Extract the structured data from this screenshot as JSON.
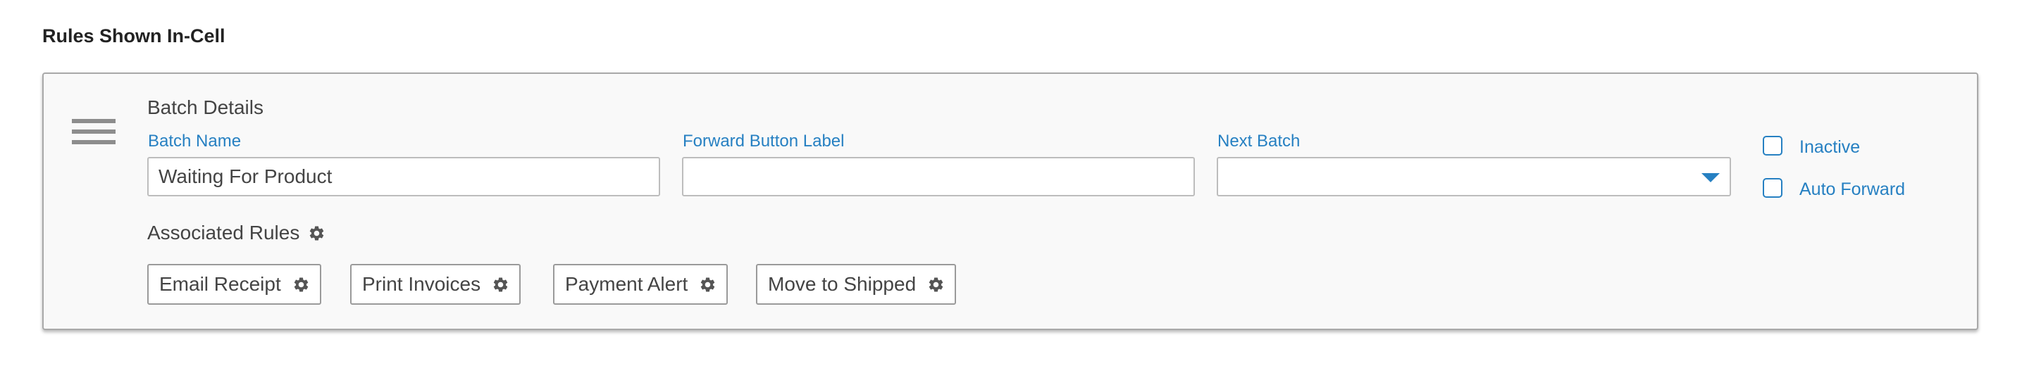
{
  "page": {
    "section_title": "Rules Shown In-Cell"
  },
  "card": {
    "heading": "Batch Details",
    "fields": {
      "batch_name": {
        "label": "Batch Name",
        "value": "Waiting For Product"
      },
      "forward_button_label": {
        "label": "Forward Button Label",
        "value": ""
      },
      "next_batch": {
        "label": "Next Batch",
        "value": ""
      }
    },
    "checkboxes": {
      "inactive": {
        "label": "Inactive",
        "checked": false
      },
      "auto_forward": {
        "label": "Auto Forward",
        "checked": false
      }
    },
    "associated_rules": {
      "heading": "Associated Rules",
      "rules": [
        "Email Receipt",
        "Print Invoices",
        "Payment Alert",
        "Move to Shipped"
      ]
    }
  },
  "icons": {
    "drag_handle": "hamburger-icon",
    "rule_settings": "gear-icon",
    "select_caret": "caret-down-icon"
  },
  "colors": {
    "accent": "#2680c2",
    "border": "#bdbdbd",
    "card_background": "#f9f9f9"
  }
}
